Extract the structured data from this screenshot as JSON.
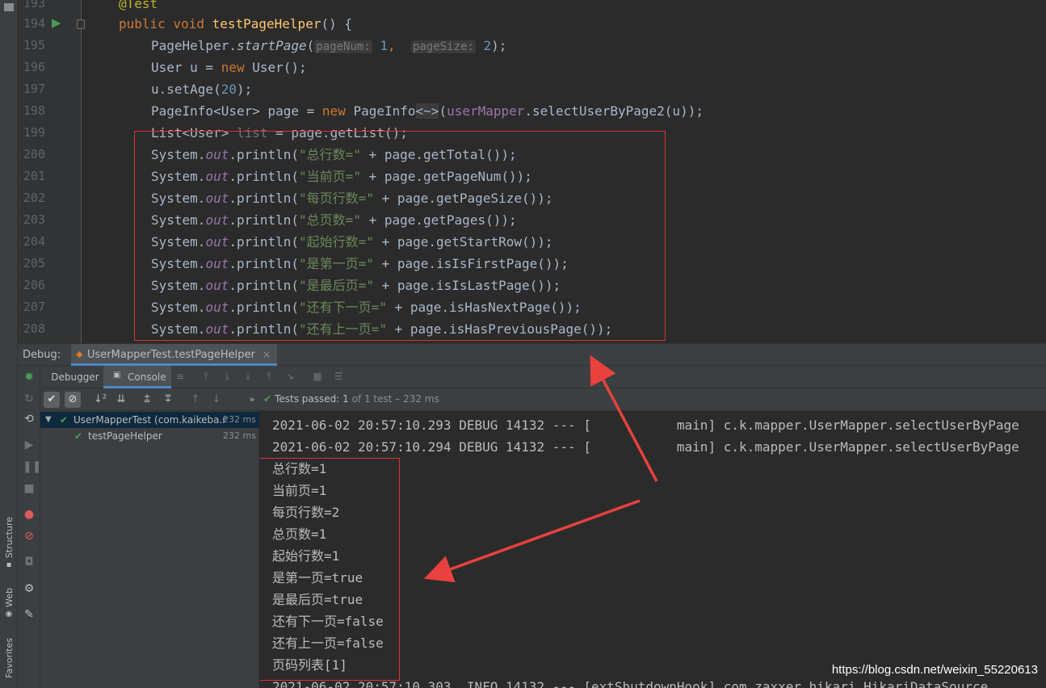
{
  "sidebar": {
    "structure_label": "Structure",
    "web_label": "Web",
    "favorites_label": "Favorites"
  },
  "editor": {
    "line_numbers": [
      "193",
      "194",
      "195",
      "196",
      "197",
      "198",
      "199",
      "200",
      "201",
      "202",
      "203",
      "204",
      "205",
      "206",
      "207",
      "208"
    ],
    "lines": {
      "l193": "@Test",
      "l194_kw": "public void ",
      "l194_fn": "testPageHelper",
      "l194_rest": "() {",
      "l195_a": "PageHelper.",
      "l195_b": "startPage",
      "l195_c": "(",
      "l195_hint1": "pageNum:",
      "l195_v1": "1",
      "l195_d": ", ",
      "l195_hint2": "pageSize:",
      "l195_v2": "2",
      "l195_e": ");",
      "l196_a": "User u = ",
      "l196_kw": "new",
      "l196_b": " User();",
      "l197_a": "u.setAge(",
      "l197_num": "20",
      "l197_b": ");",
      "l198_a": "PageInfo<User> page = ",
      "l198_kw": "new",
      "l198_b": " PageInfo",
      "l198_dia": "<~>",
      "l198_c": "(",
      "l198_fld": "userMapper",
      "l198_d": ".selectUserByPage2(u));",
      "l199_a": "List<User> ",
      "l199_un": "list",
      "l199_b": " = page.getList();"
    },
    "println_lines": [
      {
        "str": "\"总行数=\"",
        "call": " + page.getTotal());"
      },
      {
        "str": "\"当前页=\"",
        "call": " + page.getPageNum());"
      },
      {
        "str": "\"每页行数=\"",
        "call": " + page.getPageSize());"
      },
      {
        "str": "\"总页数=\"",
        "call": " + page.getPages());"
      },
      {
        "str": "\"起始行数=\"",
        "call": " + page.getStartRow());"
      },
      {
        "str": "\"是第一页=\"",
        "call": " + page.isIsFirstPage());"
      },
      {
        "str": "\"是最后页=\"",
        "call": " + page.isIsLastPage());"
      },
      {
        "str": "\"还有下一页=\"",
        "call": " + page.isHasNextPage());"
      },
      {
        "str": "\"还有上一页=\"",
        "call": " + page.isHasPreviousPage());"
      }
    ],
    "sys": "System.",
    "out": "out",
    "println": ".println("
  },
  "debug": {
    "label": "Debug:",
    "tab_title": "UserMapperTest.testPageHelper",
    "close": "×",
    "debugger_tab": "Debugger",
    "console_tab": "Console",
    "tests_passed": "Tests passed:",
    "count": "1",
    "of_total": "of 1 test – 232 ms"
  },
  "test_tree": [
    {
      "name": "UserMapperTest (com.kaikeba.r",
      "time": "232 ms"
    },
    {
      "name": "testPageHelper",
      "time": "232 ms"
    }
  ],
  "console": {
    "log1": "2021-06-02 20:57:10.293 DEBUG 14132 --- [           main] c.k.mapper.UserMapper.selectUserByPage",
    "log2": "2021-06-02 20:57:10.294 DEBUG 14132 --- [           main] c.k.mapper.UserMapper.selectUserByPage",
    "outputs": [
      "总行数=1",
      "当前页=1",
      "每页行数=2",
      "总页数=1",
      "起始行数=1",
      "是第一页=true",
      "是最后页=true",
      "还有下一页=false",
      "还有上一页=false",
      "页码列表[1]"
    ],
    "log3": "2021-06-02 20:57:10.303  INFO 14132 --- [extShutdownHook] com.zaxxer.hikari.HikariDataSource"
  },
  "watermark": "https://blog.csdn.net/weixin_55220613",
  "colors": {
    "annotation_box": "#e03131",
    "pass_green": "#499c54",
    "accent_blue": "#4a88c7"
  }
}
